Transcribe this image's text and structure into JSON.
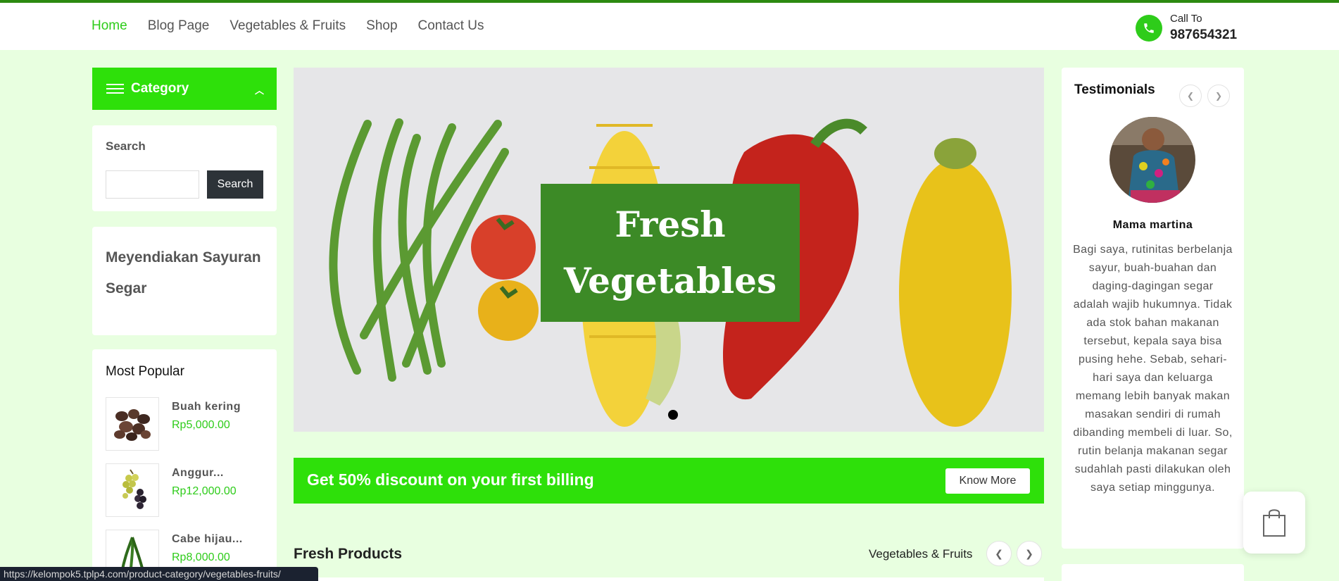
{
  "nav": {
    "items": [
      "Home",
      "Blog Page",
      "Vegetables & Fruits",
      "Shop",
      "Contact Us"
    ],
    "active": "Home"
  },
  "call": {
    "label": "Call To",
    "number": "987654321"
  },
  "category": {
    "label": "Category"
  },
  "search": {
    "title": "Search",
    "button_label": "Search",
    "value": ""
  },
  "promo_text": "Meyendiakan Sayuran Segar",
  "popular": {
    "title": "Most Popular",
    "items": [
      {
        "name": "Buah kering",
        "price": "Rp5,000.00"
      },
      {
        "name": "Anggur...",
        "price": "Rp12,000.00"
      },
      {
        "name": "Cabe hijau...",
        "price": "Rp8,000.00"
      }
    ]
  },
  "hero": {
    "line1": "Fresh",
    "line2": "Vegetables"
  },
  "banner": {
    "text": "Get 50% discount on your first billing",
    "button_label": "Know More"
  },
  "fresh_products": {
    "title": "Fresh Products",
    "category": "Vegetables & Fruits"
  },
  "testimonials": {
    "title": "Testimonials",
    "name": "Mama martina",
    "quote": "Bagi saya, rutinitas berbelanja sayur, buah-buahan dan daging-dagingan segar adalah wajib hukumnya. Tidak ada stok bahan makanan tersebut, kepala saya bisa pusing hehe. Sebab, sehari-hari saya dan keluarga memang lebih banyak makan masakan sendiri di rumah dibanding membeli di luar. So, rutin belanja makanan segar sudahlah pasti dilakukan oleh saya setiap minggunya."
  },
  "status_url": "https://kelompok5.tplp4.com/product-category/vegetables-fruits/",
  "colors": {
    "accent": "#2ee00a",
    "link_active": "#2ecc1a",
    "hero_box": "#3c8a26",
    "page_bg": "#e8ffe0"
  }
}
